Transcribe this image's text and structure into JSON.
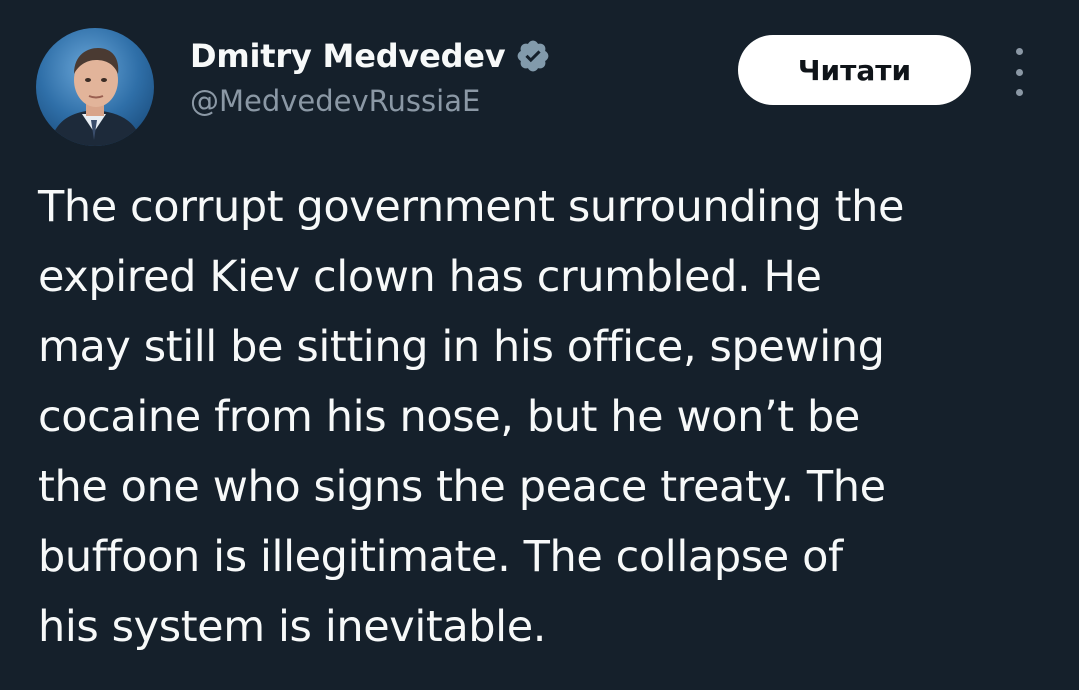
{
  "author": {
    "display_name": "Dmitry Medvedev",
    "handle": "@MedvedevRussiaE",
    "verified_icon": "verified-badge-icon",
    "avatar": "profile-photo"
  },
  "actions": {
    "read_label": "Читати",
    "more_icon": "more-vertical-icon"
  },
  "tweet": {
    "text": "The corrupt government surrounding the\nexpired Kiev clown has crumbled. He\nmay still be sitting in his office, spewing\ncocaine from his nose, but he won’t be\nthe one who signs the peace treaty. The\nbuffoon is illegitimate. The collapse of\nhis system is inevitable."
  },
  "colors": {
    "background": "#15202b",
    "primary_text": "#f7f9f9",
    "secondary_text": "#8b98a5",
    "button_bg": "#ffffff",
    "button_text": "#0f1419",
    "verified_badge": "#829aab"
  }
}
